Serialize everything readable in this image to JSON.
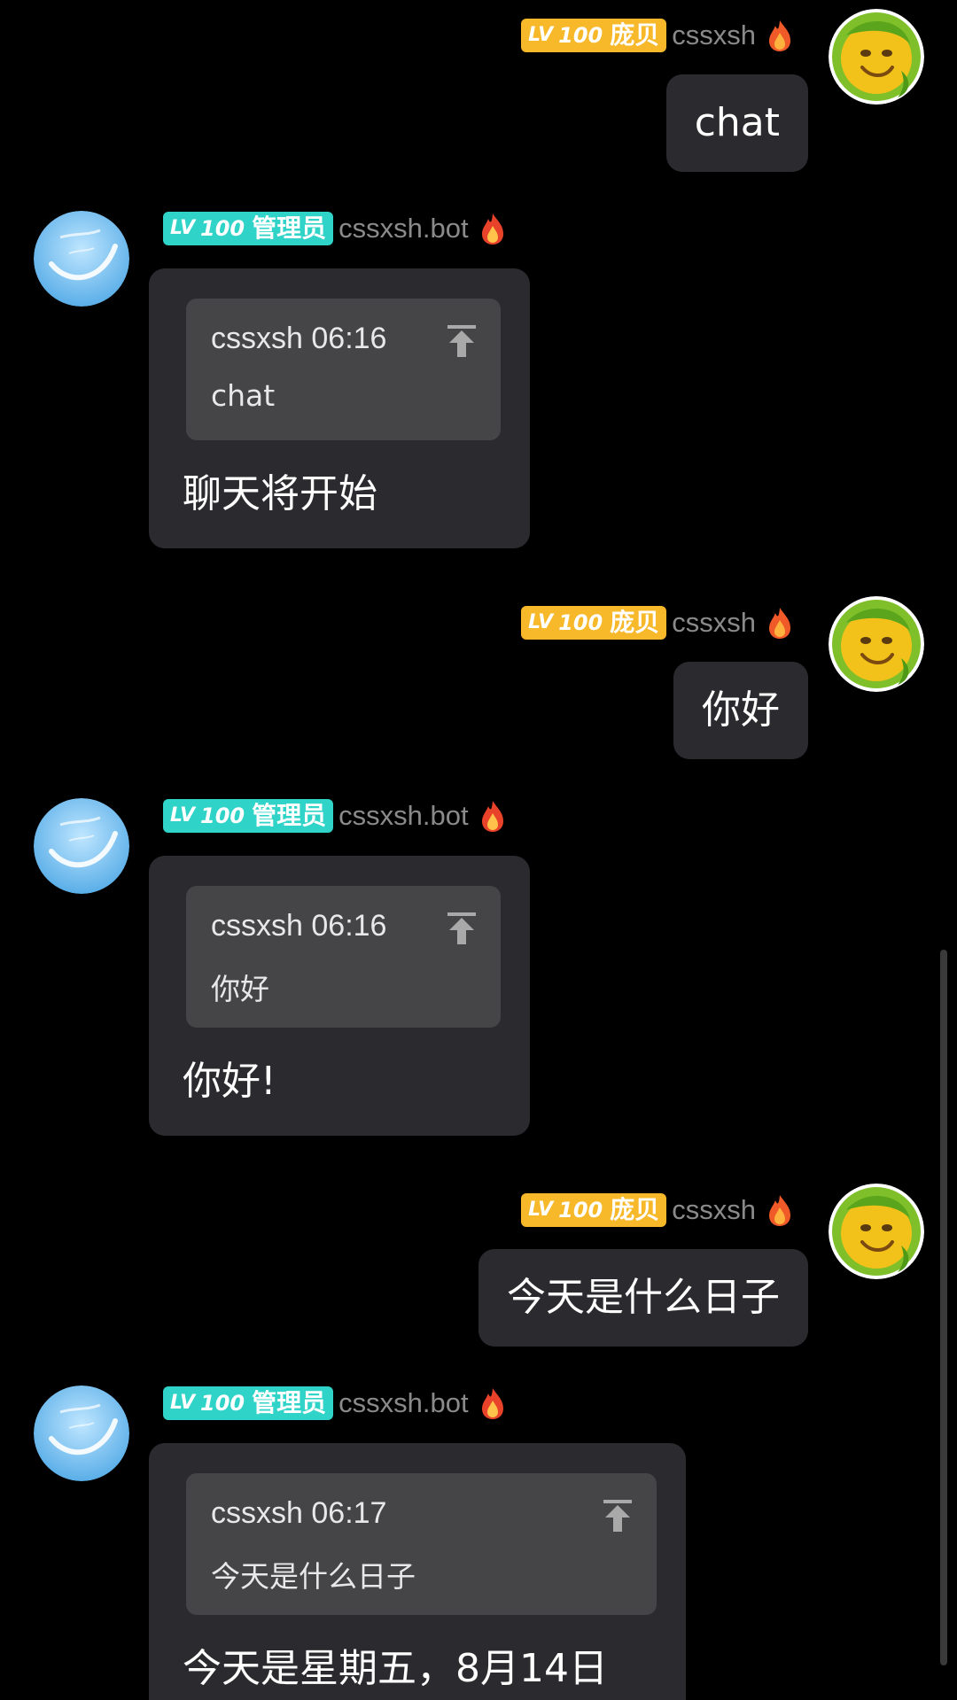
{
  "badges": {
    "user": {
      "lv": "LV",
      "level": "100",
      "title": "庞贝"
    },
    "bot": {
      "lv": "LV",
      "level": "100",
      "title": "管理员"
    }
  },
  "users": {
    "human": {
      "name": "cssxsh",
      "icon": "fire-icon"
    },
    "bot": {
      "name": "cssxsh.bot",
      "icon": "fire-icon"
    }
  },
  "colors": {
    "background": "#000000",
    "bubble": "#2b2a2e",
    "quote": "#454447",
    "badge_gold": "#f7b829",
    "badge_teal": "#2fd3c7",
    "username": "#8a8a8a"
  },
  "messages": [
    {
      "role": "user",
      "text": "chat"
    },
    {
      "role": "bot",
      "quote_author": "cssxsh",
      "quote_time": "06:16",
      "quote_text": "chat",
      "reply": "聊天将开始"
    },
    {
      "role": "user",
      "text": "你好"
    },
    {
      "role": "bot",
      "quote_author": "cssxsh",
      "quote_time": "06:16",
      "quote_text": "你好",
      "reply": "你好!"
    },
    {
      "role": "user",
      "text": "今天是什么日子"
    },
    {
      "role": "bot",
      "quote_author": "cssxsh",
      "quote_time": "06:17",
      "quote_text": "今天是什么日子",
      "reply": "今天是星期五，8月14日"
    }
  ]
}
